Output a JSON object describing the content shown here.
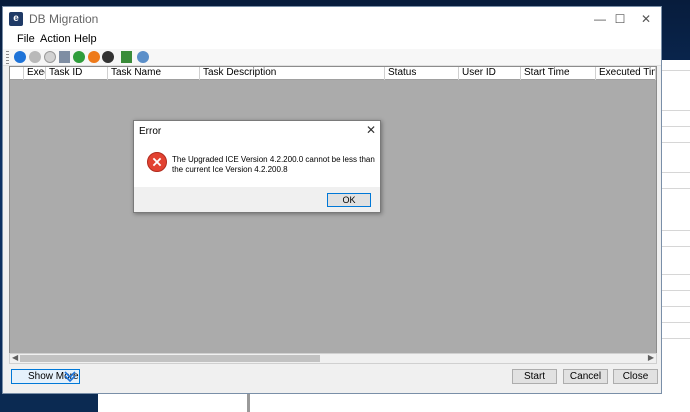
{
  "window": {
    "title": "DB Migration",
    "controls": [
      "—",
      "☐",
      "✕"
    ]
  },
  "menu": {
    "items": [
      "File",
      "Action",
      "Help"
    ]
  },
  "toolbar": {
    "icons": [
      "play-icon",
      "stop-icon",
      "settings-icon",
      "document-icon",
      "refresh-icon",
      "orange-icon",
      "info-icon",
      "export-icon",
      "globe-icon"
    ]
  },
  "grid": {
    "columns": [
      "Exec",
      "Task ID",
      "Task Name",
      "Task Description",
      "Status",
      "User ID",
      "Start Time",
      "Executed Time (Min)"
    ]
  },
  "bottom": {
    "show_more_label": "Show More",
    "start_label": "Start",
    "cancel_label": "Cancel",
    "close_label": "Close"
  },
  "dialog": {
    "title": "Error",
    "message": "The Upgraded ICE Version 4.2.200.0 cannot be less than the current Ice Version 4.2.200.8",
    "ok_label": "OK"
  },
  "colors": {
    "error_red": "#e24231",
    "accent_blue": "#0078d7",
    "grid_background": "#ababab"
  }
}
